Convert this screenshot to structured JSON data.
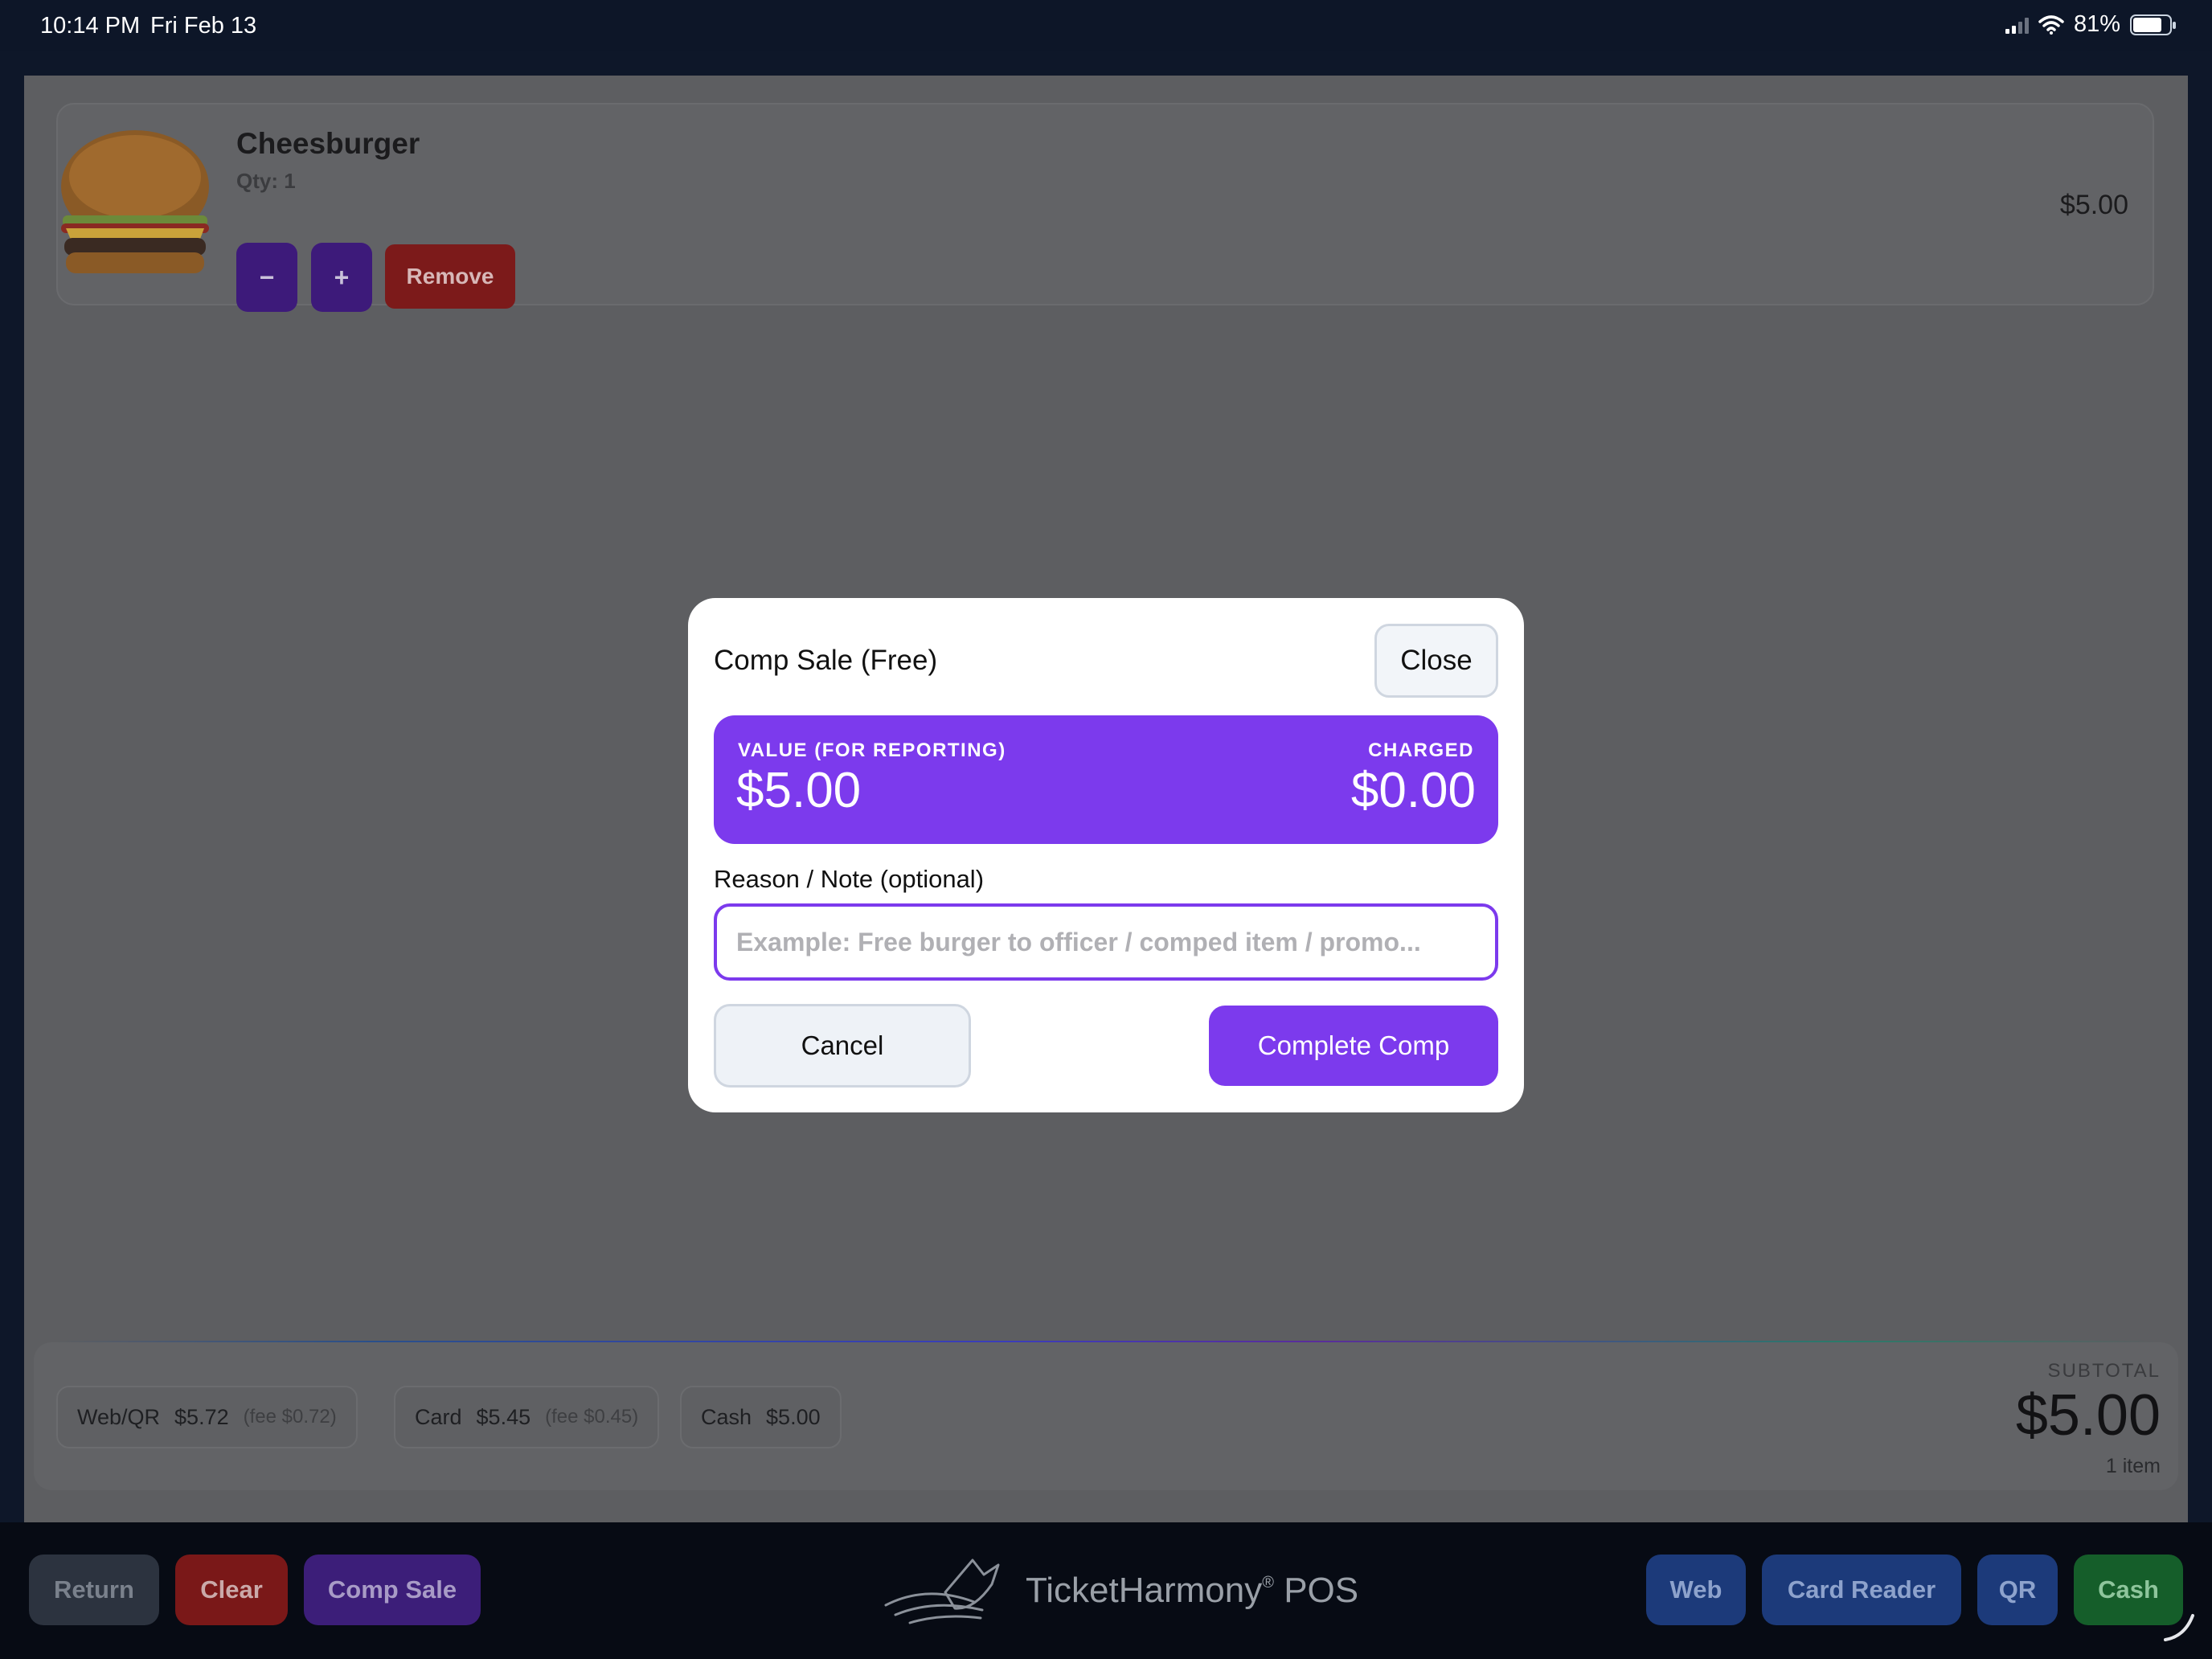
{
  "status_bar": {
    "time": "10:14 PM",
    "date": "Fri Feb 13",
    "battery": "81%",
    "icons": [
      "cellular-signal-icon",
      "wifi-icon",
      "battery-icon"
    ]
  },
  "cart": {
    "items": [
      {
        "name": "Cheesburger",
        "qty": "Qty: 1",
        "price": "$5.00",
        "minus_label": "−",
        "plus_label": "+",
        "remove_label": "Remove"
      }
    ]
  },
  "totals": {
    "web": {
      "label": "Web/QR",
      "amount": "$5.72",
      "fee": "(fee $0.72)"
    },
    "card": {
      "label": "Card",
      "amount": "$5.45",
      "fee": "(fee $0.45)"
    },
    "cash": {
      "label": "Cash",
      "amount": "$5.00"
    },
    "subtotal_label": "SUBTOTAL",
    "subtotal_value": "$5.00",
    "item_count": "1 item"
  },
  "toolbar": {
    "return_label": "Return",
    "clear_label": "Clear",
    "comp_label": "Comp Sale",
    "brand_name": "TicketHarmony",
    "brand_reg": "®",
    "brand_suffix": "POS",
    "web_label": "Web",
    "card_reader_label": "Card Reader",
    "qr_label": "QR",
    "cash_label": "Cash"
  },
  "modal": {
    "title": "Comp Sale (Free)",
    "close_label": "Close",
    "value_label": "VALUE (FOR REPORTING)",
    "value_amount": "$5.00",
    "charged_label": "CHARGED",
    "charged_amount": "$0.00",
    "note_label": "Reason / Note (optional)",
    "note_value": "",
    "note_placeholder": "Example: Free burger to officer / comped item / promo...",
    "cancel_label": "Cancel",
    "complete_label": "Complete Comp"
  },
  "colors": {
    "accent_purple": "#7c3aed",
    "danger_red": "#7a1818",
    "primary_blue": "#1c3a7a",
    "success_green": "#155e2a",
    "background_navy": "#0e1729"
  }
}
